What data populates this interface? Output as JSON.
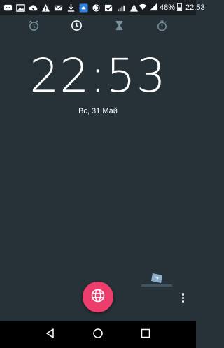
{
  "status_bar": {
    "left_icons": [
      "chat-icon",
      "image-icon",
      "cloud-upload-icon",
      "warning-icon",
      "mail-icon",
      "download-icon",
      "app-icon",
      "sync-icon",
      "checkbox-icon",
      "signal-icon",
      "warning-icon"
    ],
    "battery_percent": "48%",
    "time": "22:53"
  },
  "tabs": [
    {
      "icon": "alarm-icon",
      "active": false
    },
    {
      "icon": "clock-icon",
      "active": true
    },
    {
      "icon": "timer-icon",
      "active": false
    },
    {
      "icon": "stopwatch-icon",
      "active": false
    }
  ],
  "clock": {
    "time": "22:53",
    "date": "Вс, 31 Май"
  },
  "fab": {
    "icon": "globe-icon"
  },
  "nav": [
    "back-icon",
    "home-icon",
    "recents-icon"
  ],
  "colors": {
    "background": "#263238",
    "accent": "#ee3d6d",
    "status_bar": "#1a1f23",
    "nav_bar": "#000000"
  }
}
